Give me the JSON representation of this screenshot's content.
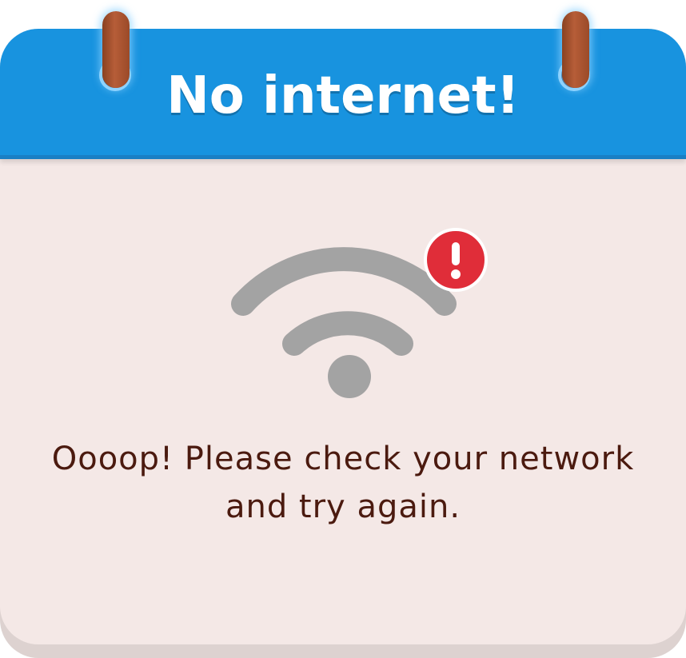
{
  "dialog": {
    "title": "No internet!",
    "message_line1": "Oooop! Please check your network",
    "message_line2": "and try again."
  },
  "icons": {
    "status": "wifi-icon",
    "alert": "exclamation-icon"
  },
  "colors": {
    "header": "#1893df",
    "card": "#f4e8e6",
    "wifi": "#a3a3a3",
    "alert": "#e02d39",
    "text": "#4b1a0f"
  }
}
